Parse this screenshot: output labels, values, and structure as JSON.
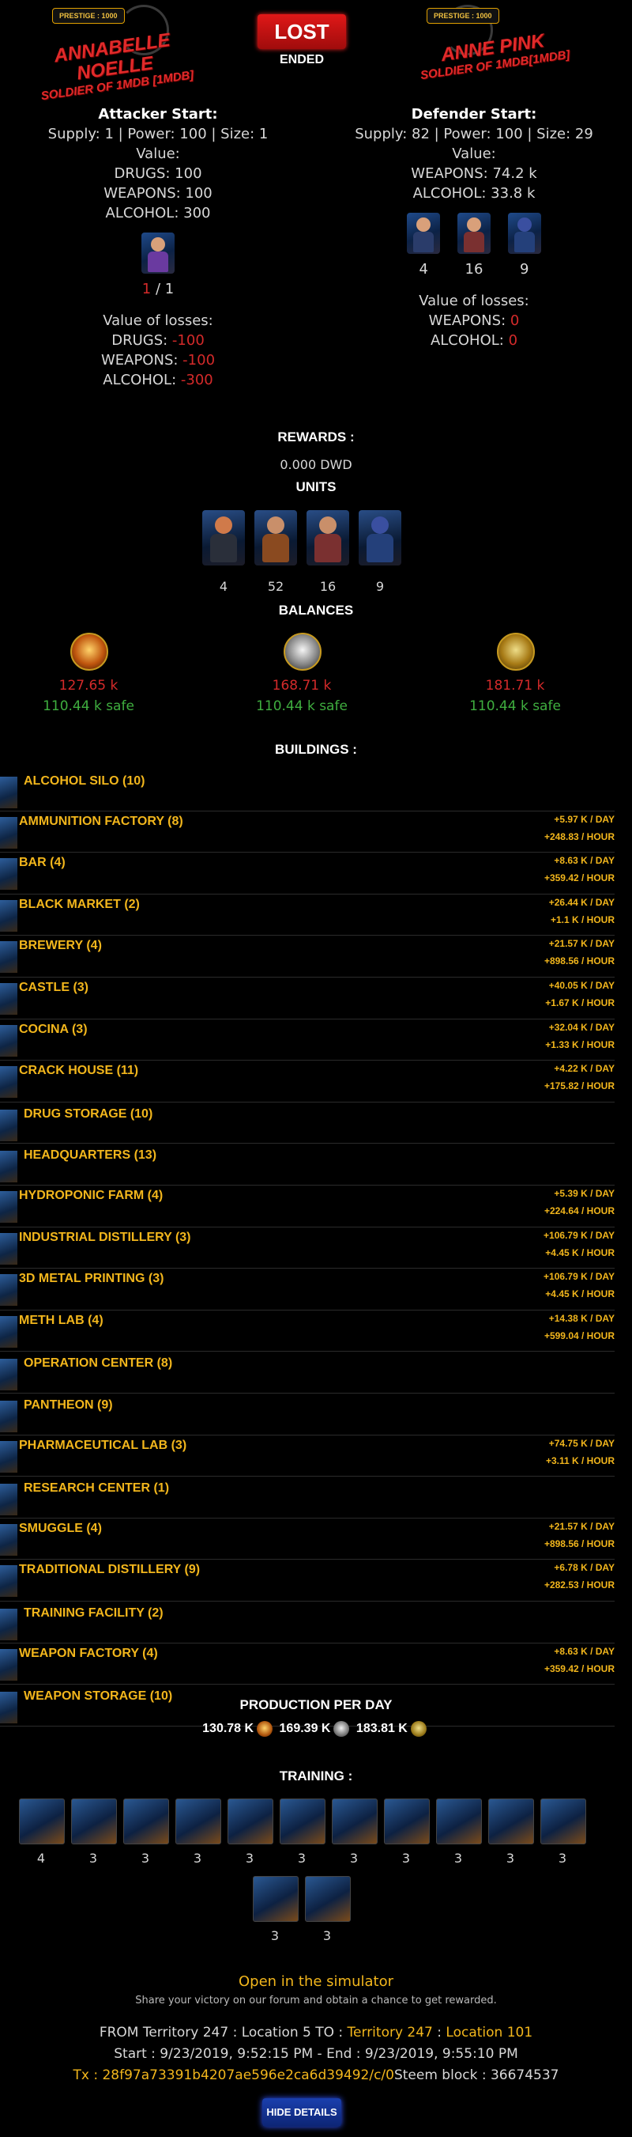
{
  "battle": {
    "result": "LOST",
    "status": "ENDED"
  },
  "attacker": {
    "prestige": "PRESTIGE : 1000",
    "name": "ANNABELLE NOELLE",
    "subtitle": "SOLDIER OF 1MDB [1MDB]",
    "heading": "Attacker Start:",
    "stats": "Supply: 1 | Power: 100 | Size: 1",
    "value_label": "Value:",
    "values": [
      "DRUGS: 100",
      "WEAPONS: 100",
      "ALCOHOL: 300"
    ],
    "units_left": "1",
    "units_total": "/ 1",
    "losses_label": "Value of losses:",
    "losses": [
      {
        "label": "DRUGS:",
        "value": "-100"
      },
      {
        "label": "WEAPONS:",
        "value": "-100"
      },
      {
        "label": "ALCOHOL:",
        "value": "-300"
      }
    ]
  },
  "defender": {
    "prestige": "PRESTIGE : 1000",
    "name": "ANNE PINK",
    "subtitle": "SOLDIER OF 1MDB[1MDB]",
    "heading": "Defender Start:",
    "stats": "Supply: 82 | Power: 100 | Size: 29",
    "value_label": "Value:",
    "values": [
      "WEAPONS: 74.2 k",
      "ALCOHOL: 33.8 k"
    ],
    "unit_counts": [
      "4",
      "16",
      "9"
    ],
    "losses_label": "Value of losses:",
    "losses": [
      {
        "label": "WEAPONS:",
        "value": "0"
      },
      {
        "label": "ALCOHOL:",
        "value": "0"
      }
    ]
  },
  "rewards": {
    "title": "REWARDS :",
    "amount": "0.000 DWD"
  },
  "units": {
    "title": "UNITS",
    "counts": [
      "4",
      "52",
      "16",
      "9"
    ]
  },
  "balances": {
    "title": "BALANCES",
    "items": [
      {
        "icon": "drugs-icon",
        "value": "127.65 k",
        "safe": "110.44 k safe"
      },
      {
        "icon": "weapons-icon",
        "value": "168.71 k",
        "safe": "110.44 k safe"
      },
      {
        "icon": "alcohol-icon",
        "value": "181.71 k",
        "safe": "110.44 k safe"
      }
    ]
  },
  "buildings": {
    "title": "BUILDINGS :",
    "items": [
      {
        "name": "ALCOHOL SILO (10)",
        "day": "",
        "hour": ""
      },
      {
        "name": "AMMUNITION FACTORY (8)",
        "day": "+5.97 K / DAY",
        "hour": "+248.83 / HOUR"
      },
      {
        "name": "BAR (4)",
        "day": "+8.63 K / DAY",
        "hour": "+359.42 / HOUR"
      },
      {
        "name": "BLACK MARKET (2)",
        "day": "+26.44 K / DAY",
        "hour": "+1.1 K / HOUR"
      },
      {
        "name": "BREWERY (4)",
        "day": "+21.57 K / DAY",
        "hour": "+898.56 / HOUR"
      },
      {
        "name": "CASTLE (3)",
        "day": "+40.05 K / DAY",
        "hour": "+1.67 K / HOUR"
      },
      {
        "name": "COCINA (3)",
        "day": "+32.04 K / DAY",
        "hour": "+1.33 K / HOUR"
      },
      {
        "name": "CRACK HOUSE (11)",
        "day": "+4.22 K / DAY",
        "hour": "+175.82 / HOUR"
      },
      {
        "name": "DRUG STORAGE (10)",
        "day": "",
        "hour": ""
      },
      {
        "name": "HEADQUARTERS (13)",
        "day": "",
        "hour": ""
      },
      {
        "name": "HYDROPONIC FARM (4)",
        "day": "+5.39 K / DAY",
        "hour": "+224.64 / HOUR"
      },
      {
        "name": "INDUSTRIAL DISTILLERY (3)",
        "day": "+106.79 K / DAY",
        "hour": "+4.45 K / HOUR"
      },
      {
        "name": "3D METAL PRINTING (3)",
        "day": "+106.79 K / DAY",
        "hour": "+4.45 K / HOUR"
      },
      {
        "name": "METH LAB (4)",
        "day": "+14.38 K / DAY",
        "hour": "+599.04 / HOUR"
      },
      {
        "name": "OPERATION CENTER (8)",
        "day": "",
        "hour": ""
      },
      {
        "name": "PANTHEON (9)",
        "day": "",
        "hour": ""
      },
      {
        "name": "PHARMACEUTICAL LAB (3)",
        "day": "+74.75 K / DAY",
        "hour": "+3.11 K / HOUR"
      },
      {
        "name": "RESEARCH CENTER (1)",
        "day": "",
        "hour": ""
      },
      {
        "name": "SMUGGLE (4)",
        "day": "+21.57 K / DAY",
        "hour": "+898.56 / HOUR"
      },
      {
        "name": "TRADITIONAL DISTILLERY (9)",
        "day": "+6.78 K / DAY",
        "hour": "+282.53 / HOUR"
      },
      {
        "name": "TRAINING FACILITY (2)",
        "day": "",
        "hour": ""
      },
      {
        "name": "WEAPON FACTORY (4)",
        "day": "+8.63 K / DAY",
        "hour": "+359.42 / HOUR"
      },
      {
        "name": "WEAPON STORAGE (10)",
        "day": "",
        "hour": ""
      }
    ]
  },
  "production": {
    "title": "PRODUCTION PER DAY",
    "drugs": "130.78 K",
    "weapons": "169.39 K",
    "alcohol": "183.81 K"
  },
  "training": {
    "title": "TRAINING :",
    "counts": [
      "4",
      "3",
      "3",
      "3",
      "3",
      "3",
      "3",
      "3",
      "3",
      "3",
      "3",
      "3",
      "3"
    ]
  },
  "footer": {
    "simulator_link": "Open in the simulator",
    "share_text": "Share your victory on our forum and obtain a chance to get rewarded.",
    "route_from": "FROM Territory 247 : Location 5 TO :",
    "route_to_territory": "Territory 247",
    "route_to_location": "Location 101",
    "times": "Start : 9/23/2019, 9:52:15 PM - End : 9/23/2019, 9:55:10 PM",
    "tx_label": "Tx : 28f97a73391b4207ae596e2ca6d39492/c/0",
    "steem_block": "Steem block : 36674537",
    "hide_button": "HIDE DETAILS"
  }
}
